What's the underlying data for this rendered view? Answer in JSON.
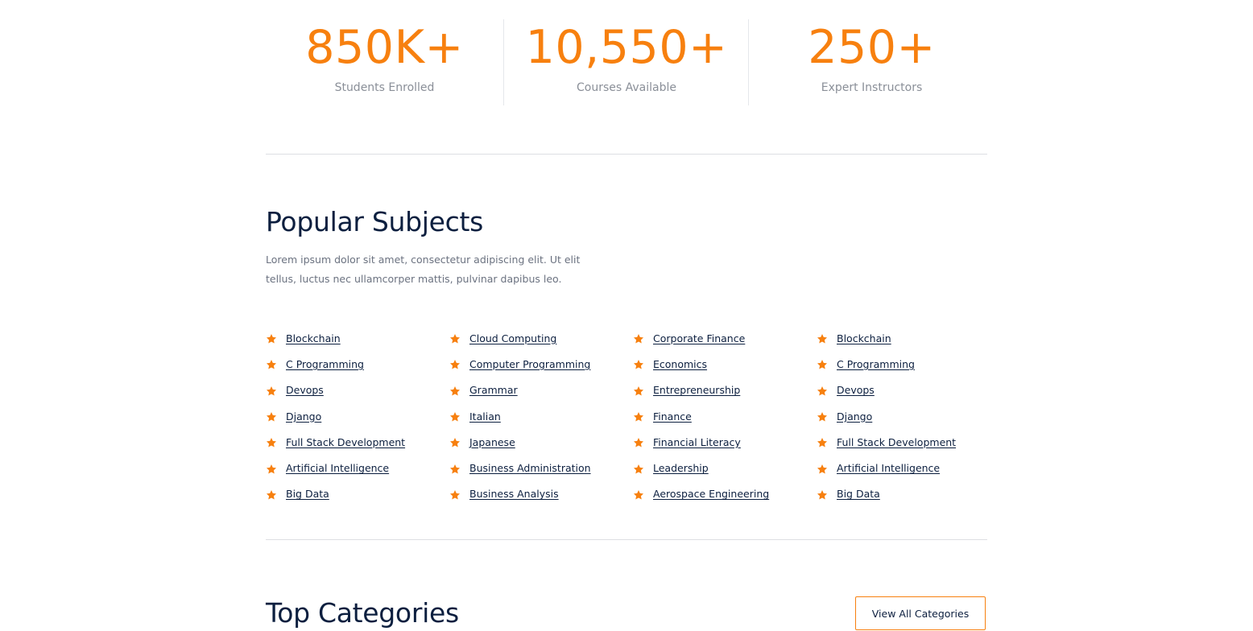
{
  "stats": [
    {
      "value": "850K+",
      "label": "Students Enrolled"
    },
    {
      "value": "10,550+",
      "label": "Courses Available"
    },
    {
      "value": "250+",
      "label": "Expert Instructors"
    }
  ],
  "popular_subjects": {
    "title": "Popular Subjects",
    "description": "Lorem ipsum dolor sit amet, consectetur adipiscing elit. Ut elit tellus, luctus nec ullamcorper mattis, pulvinar dapibus leo.",
    "icon": "star-icon",
    "columns": [
      [
        "Blockchain",
        "C Programming",
        "Devops",
        "Django",
        "Full Stack Development",
        "Artificial Intelligence",
        "Big Data"
      ],
      [
        "Cloud Computing",
        "Computer Programming",
        "Grammar",
        "Italian",
        "Japanese",
        "Business Administration",
        "Business Analysis"
      ],
      [
        "Corporate Finance",
        "Economics",
        "Entrepreneurship",
        "Finance",
        "Financial Literacy",
        "Leadership",
        "Aerospace Engineering"
      ],
      [
        "Blockchain",
        "C Programming",
        "Devops",
        "Django",
        "Full Stack Development",
        "Artificial Intelligence",
        "Big Data"
      ]
    ]
  },
  "top_categories": {
    "title": "Top Categories",
    "view_all_label": "View All Categories"
  },
  "colors": {
    "accent": "#f7800f",
    "heading": "#0c1f3f",
    "muted": "#8a8f98",
    "divider": "#dddfe3"
  }
}
